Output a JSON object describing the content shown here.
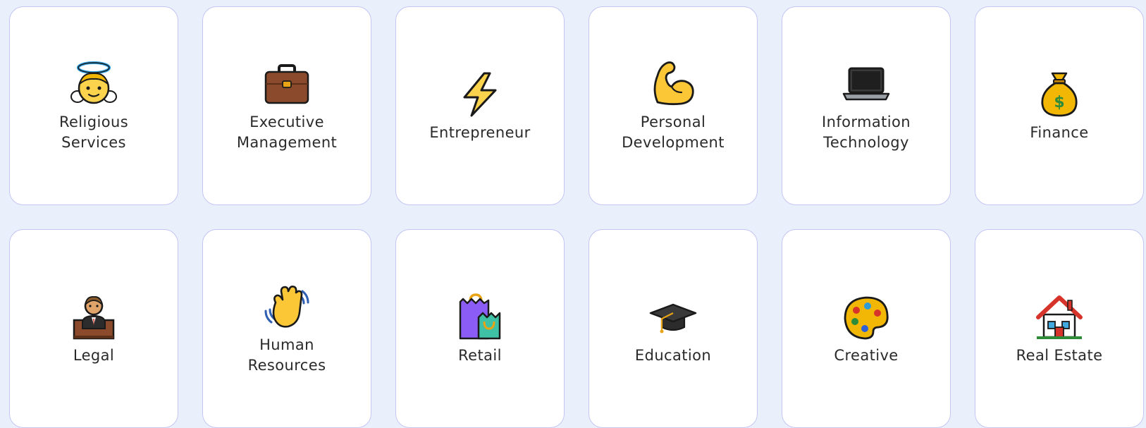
{
  "categories": [
    {
      "label": "Religious\nServices",
      "icon": "angel-icon"
    },
    {
      "label": "Executive\nManagement",
      "icon": "briefcase-icon"
    },
    {
      "label": "Entrepreneur",
      "icon": "lightning-bolt-icon"
    },
    {
      "label": "Personal\nDevelopment",
      "icon": "flexed-biceps-icon"
    },
    {
      "label": "Information\nTechnology",
      "icon": "laptop-icon"
    },
    {
      "label": "Finance",
      "icon": "money-bag-icon"
    },
    {
      "label": "Legal",
      "icon": "judge-icon"
    },
    {
      "label": "Human\nResources",
      "icon": "waving-hand-icon"
    },
    {
      "label": "Retail",
      "icon": "shopping-bags-icon"
    },
    {
      "label": "Education",
      "icon": "graduation-cap-icon"
    },
    {
      "label": "Creative",
      "icon": "artist-palette-icon"
    },
    {
      "label": "Real Estate",
      "icon": "house-icon"
    }
  ]
}
